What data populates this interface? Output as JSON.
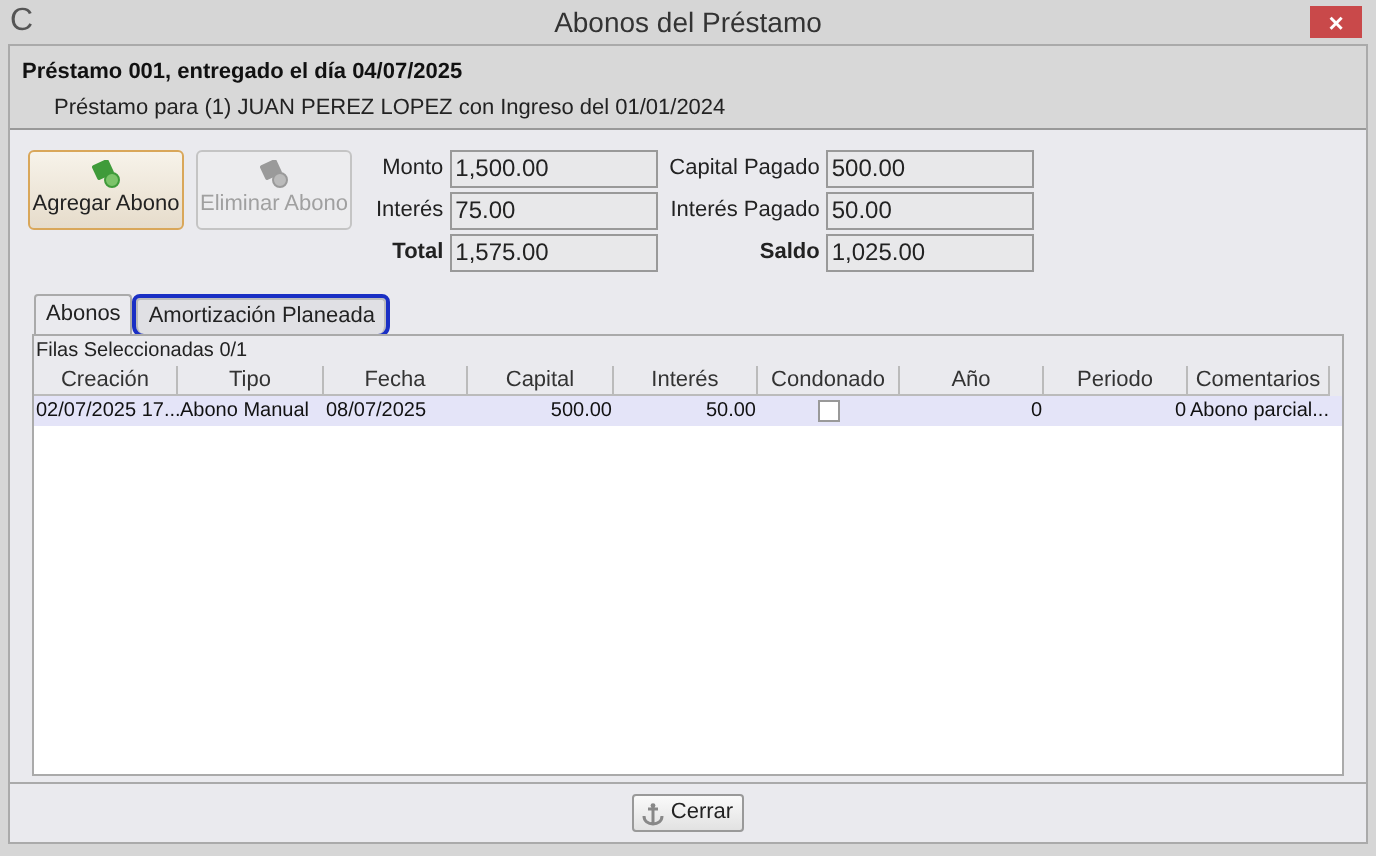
{
  "window": {
    "title": "Abonos del Préstamo",
    "icon": "C",
    "close": "×"
  },
  "header": {
    "title": "Préstamo 001, entregado el día 04/07/2025",
    "subtitle": "Préstamo para (1) JUAN PEREZ LOPEZ con Ingreso del 01/01/2024"
  },
  "actions": [
    {
      "label": "Agregar Abono",
      "disabled": false,
      "focused": true
    },
    {
      "label": "Eliminar Abono",
      "disabled": true,
      "focused": false
    }
  ],
  "fields_left": [
    {
      "label": "Monto",
      "value": "1,500.00",
      "bold": false
    },
    {
      "label": "Interés",
      "value": "75.00",
      "bold": false
    },
    {
      "label": "Total",
      "value": "1,575.00",
      "bold": true
    }
  ],
  "fields_right": [
    {
      "label": "Capital Pagado",
      "value": "500.00",
      "bold": false
    },
    {
      "label": "Interés Pagado",
      "value": "50.00",
      "bold": false
    },
    {
      "label": "Saldo",
      "value": "1,025.00",
      "bold": true
    }
  ],
  "tabs": [
    {
      "label": "Abonos",
      "selected": true,
      "focused": false
    },
    {
      "label": "Amortización Planeada",
      "selected": false,
      "focused": true
    }
  ],
  "table": {
    "selection_count": "Filas Seleccionadas 0/1",
    "columns": [
      {
        "label": "Creación"
      },
      {
        "label": "Tipo"
      },
      {
        "label": "Fecha"
      },
      {
        "label": "Capital"
      },
      {
        "label": "Interés"
      },
      {
        "label": "Condonado"
      },
      {
        "label": "Año"
      },
      {
        "label": "Periodo"
      },
      {
        "label": "Comentarios"
      }
    ],
    "rows": [
      {
        "selected": true,
        "condonado": false,
        "cells": [
          "02/07/2025 17...",
          "Abono Manual",
          "08/07/2025",
          "500.00",
          "50.00",
          null,
          "0",
          "0",
          "Abono parcial..."
        ]
      }
    ]
  },
  "footer": {
    "close_button": "Cerrar"
  }
}
